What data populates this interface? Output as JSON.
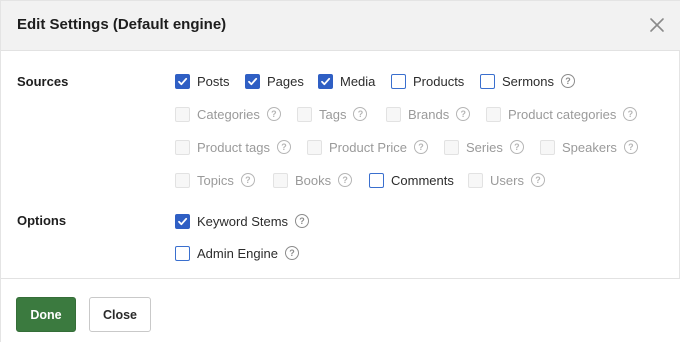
{
  "dialog": {
    "title": "Edit Settings (Default engine)",
    "close_icon": "close-icon"
  },
  "sources": {
    "label": "Sources",
    "items": [
      {
        "label": "Posts",
        "checked": true,
        "disabled": false,
        "help": false
      },
      {
        "label": "Pages",
        "checked": true,
        "disabled": false,
        "help": false
      },
      {
        "label": "Media",
        "checked": true,
        "disabled": false,
        "help": false
      },
      {
        "label": "Products",
        "checked": false,
        "disabled": false,
        "help": false
      },
      {
        "label": "Sermons",
        "checked": false,
        "disabled": false,
        "help": true
      },
      {
        "label": "Categories",
        "checked": false,
        "disabled": true,
        "help": true
      },
      {
        "label": "Tags",
        "checked": false,
        "disabled": true,
        "help": true
      },
      {
        "label": "Brands",
        "checked": false,
        "disabled": true,
        "help": true
      },
      {
        "label": "Product categories",
        "checked": false,
        "disabled": true,
        "help": true
      },
      {
        "label": "Product tags",
        "checked": false,
        "disabled": true,
        "help": true
      },
      {
        "label": "Product Price",
        "checked": false,
        "disabled": true,
        "help": true
      },
      {
        "label": "Series",
        "checked": false,
        "disabled": true,
        "help": true
      },
      {
        "label": "Speakers",
        "checked": false,
        "disabled": true,
        "help": true
      },
      {
        "label": "Topics",
        "checked": false,
        "disabled": true,
        "help": true
      },
      {
        "label": "Books",
        "checked": false,
        "disabled": true,
        "help": true
      },
      {
        "label": "Comments",
        "checked": false,
        "disabled": false,
        "help": false
      },
      {
        "label": "Users",
        "checked": false,
        "disabled": true,
        "help": true
      }
    ]
  },
  "options": {
    "label": "Options",
    "items": [
      {
        "label": "Keyword Stems",
        "checked": true,
        "disabled": false,
        "help": true
      },
      {
        "label": "Admin Engine",
        "checked": false,
        "disabled": false,
        "help": true
      }
    ]
  },
  "footer": {
    "done_label": "Done",
    "close_label": "Close"
  },
  "colors": {
    "primary_button": "#3b7a3f",
    "checkbox_checked": "#2f5fc4",
    "header_bg": "#f2f2f2"
  }
}
